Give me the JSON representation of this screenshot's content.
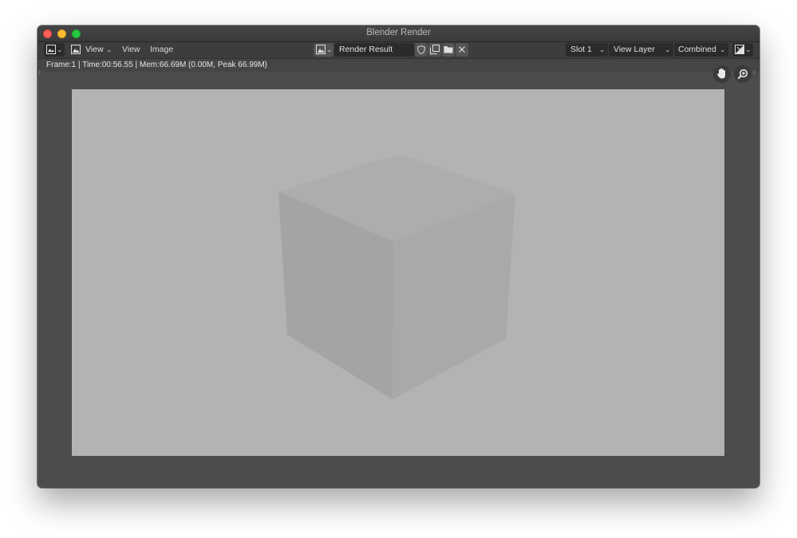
{
  "window": {
    "title": "Blender Render"
  },
  "header": {
    "editor_type_icon": "image-editor-icon",
    "view_menu": "View",
    "menu_view": "View",
    "menu_image": "Image",
    "image_browse_icon": "image-browse-icon",
    "image_name": "Render Result",
    "slot": "Slot 1",
    "view_layer": "View Layer",
    "pass": "Combined",
    "display_channels_icon": "display-channels-icon"
  },
  "info": {
    "text": "Frame:1 | Time:00:56.55 | Mem:66.69M (0.00M, Peak 66.99M)"
  },
  "colors": {
    "window_bg": "#4c4c4c",
    "header_bg": "#3d3d3d",
    "canvas_bg": "#b3b3b3",
    "cube_top": "#adadad",
    "cube_left": "#a5a5a5",
    "cube_right": "#a9a9a9"
  }
}
